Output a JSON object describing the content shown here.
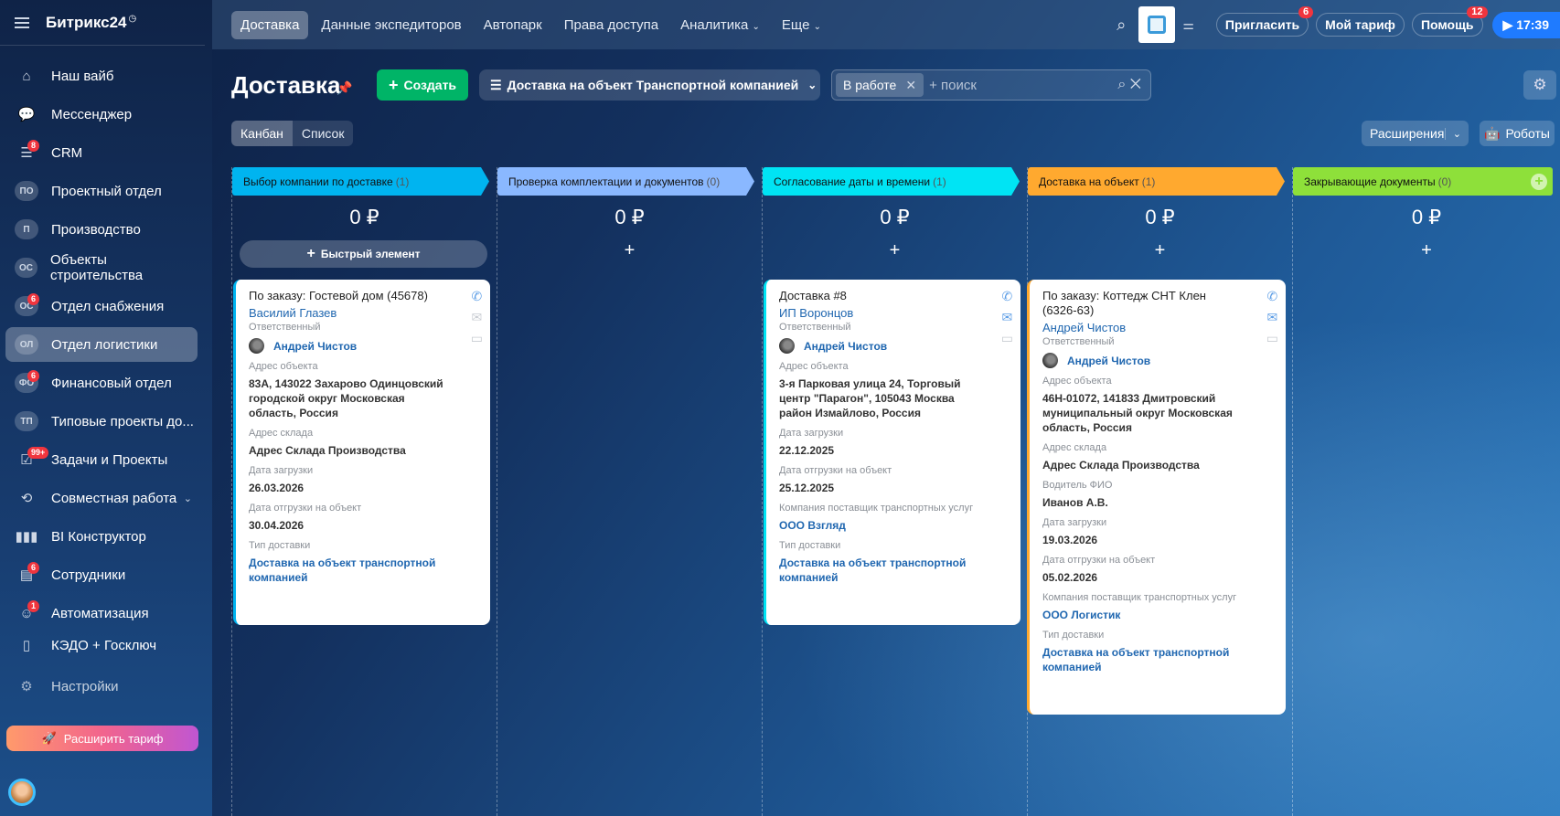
{
  "sidebar": {
    "logo": "Битрикс24",
    "items": [
      {
        "label": "Наш вайб",
        "icon": "home-icon"
      },
      {
        "label": "Мессенджер",
        "icon": "chat-icon"
      },
      {
        "label": "CRM",
        "icon": "crm-icon",
        "badge": "8"
      },
      {
        "label": "Проектный отдел",
        "abbr": "ПО"
      },
      {
        "label": "Производство",
        "abbr": "П"
      },
      {
        "label": "Объекты строительства",
        "abbr": "ОС"
      },
      {
        "label": "Отдел снабжения",
        "abbr": "ОС",
        "badge": "6"
      },
      {
        "label": "Отдел логистики",
        "abbr": "ОЛ",
        "active": true
      },
      {
        "label": "Финансовый отдел",
        "abbr": "ФО",
        "badge": "6"
      },
      {
        "label": "Типовые проекты до...",
        "abbr": "ТП"
      },
      {
        "label": "Задачи и Проекты",
        "icon": "tasks-icon",
        "badge": "99+"
      },
      {
        "label": "Совместная работа",
        "icon": "collab-icon"
      },
      {
        "label": "BI Конструктор",
        "icon": "chart-icon"
      },
      {
        "label": "Сотрудники",
        "icon": "employees-icon",
        "badge": "6"
      },
      {
        "label": "Автоматизация",
        "icon": "robot-icon",
        "badge": "1"
      },
      {
        "label": "КЭДО + Госключ",
        "icon": "doc-icon"
      },
      {
        "label": "Настройки",
        "icon": "gear-icon"
      }
    ],
    "upgrade": "Расширить тариф"
  },
  "topbar": {
    "tabs": [
      "Доставка",
      "Данные экспедиторов",
      "Автопарк",
      "Права доступа",
      "Аналитика",
      "Еще"
    ],
    "invite": "Пригласить",
    "invite_badge": "6",
    "tariff": "Мой тариф",
    "help": "Помощь",
    "help_badge": "12",
    "time": "17:39"
  },
  "page": {
    "title": "Доставка",
    "create": "Создать",
    "category": "Доставка на объект Транспортной компанией",
    "filter_chip": "В работе",
    "search_placeholder": "+ поиск",
    "views": [
      "Канбан",
      "Список"
    ],
    "extensions": "Расширения",
    "robots": "Роботы"
  },
  "columns": [
    {
      "title": "Выбор компании по доставке",
      "count": "(1)",
      "sum": "0 ₽",
      "color": "#00b4f0",
      "quick": "Быстрый элемент"
    },
    {
      "title": "Проверка комплектации и документов",
      "count": "(0)",
      "sum": "0 ₽",
      "color": "#8ab8ff"
    },
    {
      "title": "Согласование даты и времени",
      "count": "(1)",
      "sum": "0 ₽",
      "color": "#00e4f4"
    },
    {
      "title": "Доставка на объект",
      "count": "(1)",
      "sum": "0 ₽",
      "color": "#ffa92f"
    },
    {
      "title": "Закрывающие документы",
      "count": "(0)",
      "sum": "0 ₽",
      "color": "#8ee03a"
    }
  ],
  "cards": [
    {
      "title": "По заказу: Гостевой дом (45678)",
      "client": "Василий Глазев",
      "resp_label": "Ответственный",
      "resp": "Андрей Чистов",
      "fields": [
        {
          "label": "Адрес объекта",
          "value": "83А, 143022 Захарово Одинцовский городской округ Московская область, Россия"
        },
        {
          "label": "Адрес склада",
          "value": "Адрес Склада Производства"
        },
        {
          "label": "Дата загрузки",
          "value": "26.03.2026"
        },
        {
          "label": "Дата отгрузки на объект",
          "value": "30.04.2026"
        },
        {
          "label": "Тип доставки",
          "value": "Доставка на объект транспортной компанией",
          "link": true
        }
      ]
    },
    {
      "title": "Доставка #8",
      "client": "ИП Воронцов",
      "resp_label": "Ответственный",
      "resp": "Андрей Чистов",
      "fields": [
        {
          "label": "Адрес объекта",
          "value": "3-я Парковая улица 24, Торговый центр \"Парагон\", 105043 Москва район Измайлово, Россия"
        },
        {
          "label": "Дата загрузки",
          "value": "22.12.2025"
        },
        {
          "label": "Дата отгрузки на объект",
          "value": "25.12.2025"
        },
        {
          "label": "Компания поставщик транспортных услуг",
          "value": "ООО Взгляд",
          "link": true
        },
        {
          "label": "Тип доставки",
          "value": "Доставка на объект транспортной компанией",
          "link": true
        }
      ]
    },
    {
      "title": "По заказу: Коттедж СНТ Клен (6326-63)",
      "client": "Андрей Чистов",
      "resp_label": "Ответственный",
      "resp": "Андрей Чистов",
      "fields": [
        {
          "label": "Адрес объекта",
          "value": "46Н-01072, 141833 Дмитровский муниципальный округ Московская область, Россия"
        },
        {
          "label": "Адрес склада",
          "value": "Адрес Склада Производства"
        },
        {
          "label": "Водитель ФИО",
          "value": "Иванов А.В."
        },
        {
          "label": "Дата загрузки",
          "value": "19.03.2026"
        },
        {
          "label": "Дата отгрузки на объект",
          "value": "05.02.2026"
        },
        {
          "label": "Компания поставщик транспортных услуг",
          "value": "ООО Логистик",
          "link": true
        },
        {
          "label": "Тип доставки",
          "value": "Доставка на объект транспортной компанией",
          "link": true
        }
      ]
    }
  ]
}
